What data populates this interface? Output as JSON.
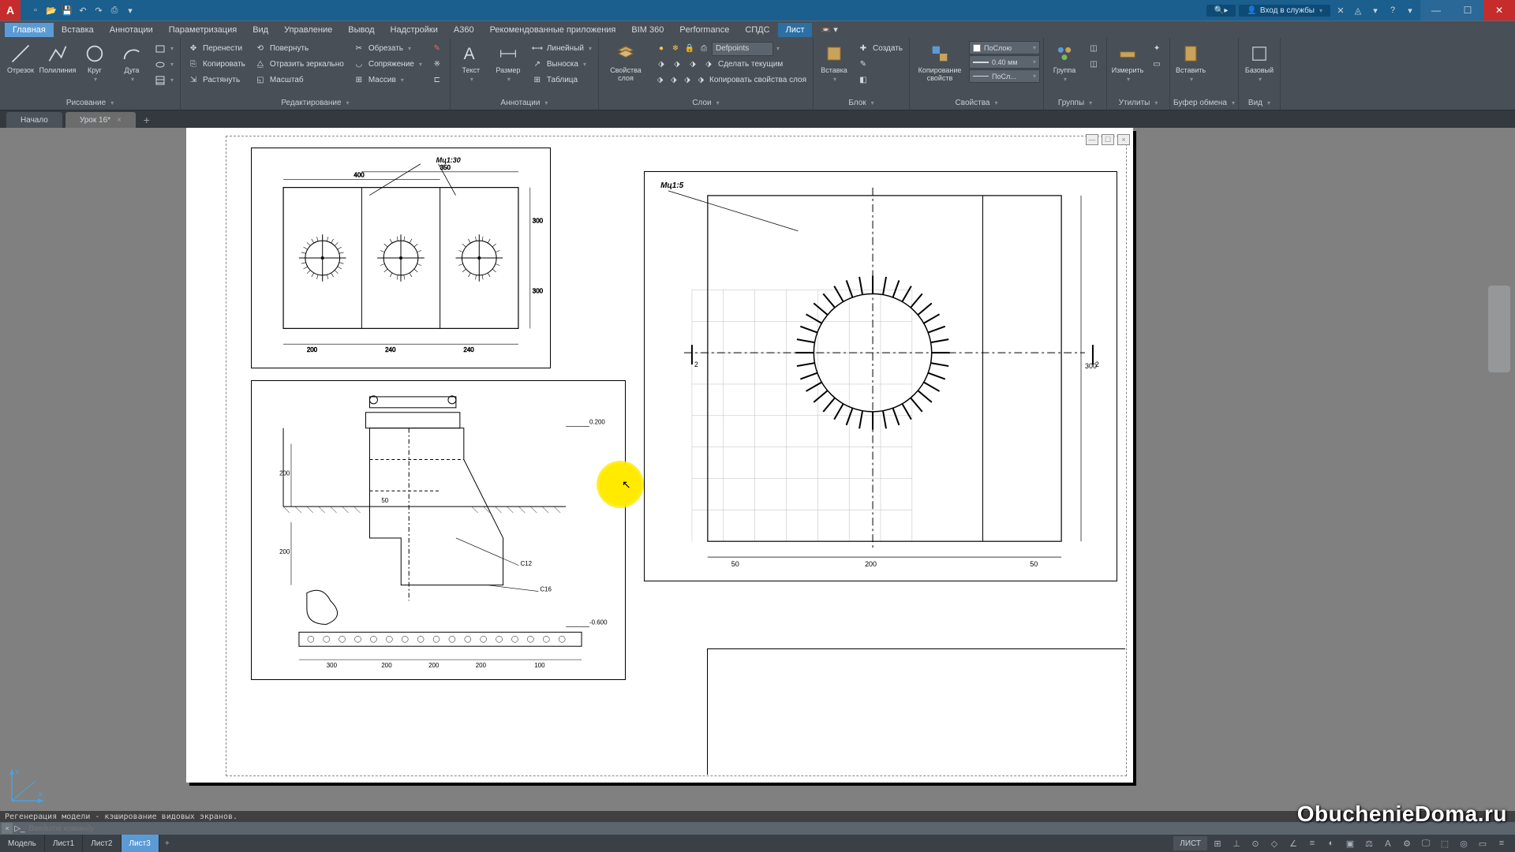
{
  "titlebar": {
    "login_text": "Вход в службы",
    "app_letter": "A"
  },
  "menubar": {
    "items": [
      "Главная",
      "Вставка",
      "Аннотации",
      "Параметризация",
      "Вид",
      "Управление",
      "Вывод",
      "Надстройки",
      "A360",
      "Рекомендованные приложения",
      "BIM 360",
      "Performance",
      "СПДС",
      "Лист"
    ]
  },
  "ribbon": {
    "draw": {
      "title": "Рисование",
      "line": "Отрезок",
      "polyline": "Полилиния",
      "circle": "Круг",
      "arc": "Дуга"
    },
    "modify": {
      "title": "Редактирование",
      "move": "Перенести",
      "rotate": "Повернуть",
      "trim": "Обрезать",
      "copy": "Копировать",
      "mirror": "Отразить зеркально",
      "fillet": "Сопряжение",
      "stretch": "Растянуть",
      "scale": "Масштаб",
      "array": "Массив"
    },
    "annot": {
      "title": "Аннотации",
      "text": "Текст",
      "dim": "Размер",
      "linear": "Линейный",
      "leader": "Выноска",
      "table": "Таблица"
    },
    "layers": {
      "title": "Слои",
      "props": "Свойства слоя",
      "current": "Defpoints",
      "makecur": "Сделать текущим",
      "copyprop": "Копировать свойства слоя"
    },
    "block": {
      "title": "Блок",
      "insert": "Вставка",
      "create": "Создать"
    },
    "props": {
      "title": "Свойства",
      "matchprop": "Копирование свойств",
      "bylayer": "ПоСлою",
      "lw": "0.40 мм",
      "lt": "ПоСл..."
    },
    "groups": {
      "title": "Группы",
      "group": "Группа"
    },
    "utils": {
      "title": "Утилиты",
      "measure": "Измерить"
    },
    "clip": {
      "title": "Буфер обмена",
      "paste": "Вставить"
    },
    "view": {
      "title": "Вид",
      "base": "Базовый"
    }
  },
  "filetabs": {
    "start": "Начало",
    "doc": "Урок 16*"
  },
  "cmd": {
    "history": "Регенерация модели - кэширование видовых экранов.",
    "placeholder": "Введите команду"
  },
  "layout": {
    "model": "Модель",
    "l1": "Лист1",
    "l2": "Лист2",
    "l3": "Лист3"
  },
  "status": {
    "mode": "ЛИСТ"
  },
  "watermark": "ObuchenieDoma.ru",
  "drawing": {
    "vp1": {
      "label": "Мц1:30",
      "w": "400",
      "mid": "350",
      "h1": "300",
      "h2": "300",
      "b1": "200",
      "b2": "240",
      "b3": "240"
    },
    "vp2": {
      "label": "Мц1:5",
      "el1": "0.200",
      "el2": "-0.600",
      "c1": "C12",
      "c2": "C16",
      "h1": "200",
      "h2": "200",
      "d1": "300",
      "d2": "200",
      "d3": "200",
      "d4": "200",
      "d5": "100",
      "s": "50"
    },
    "vp3": {
      "label": "Мц1:5",
      "span": "200",
      "side": "50",
      "h": "300"
    }
  }
}
